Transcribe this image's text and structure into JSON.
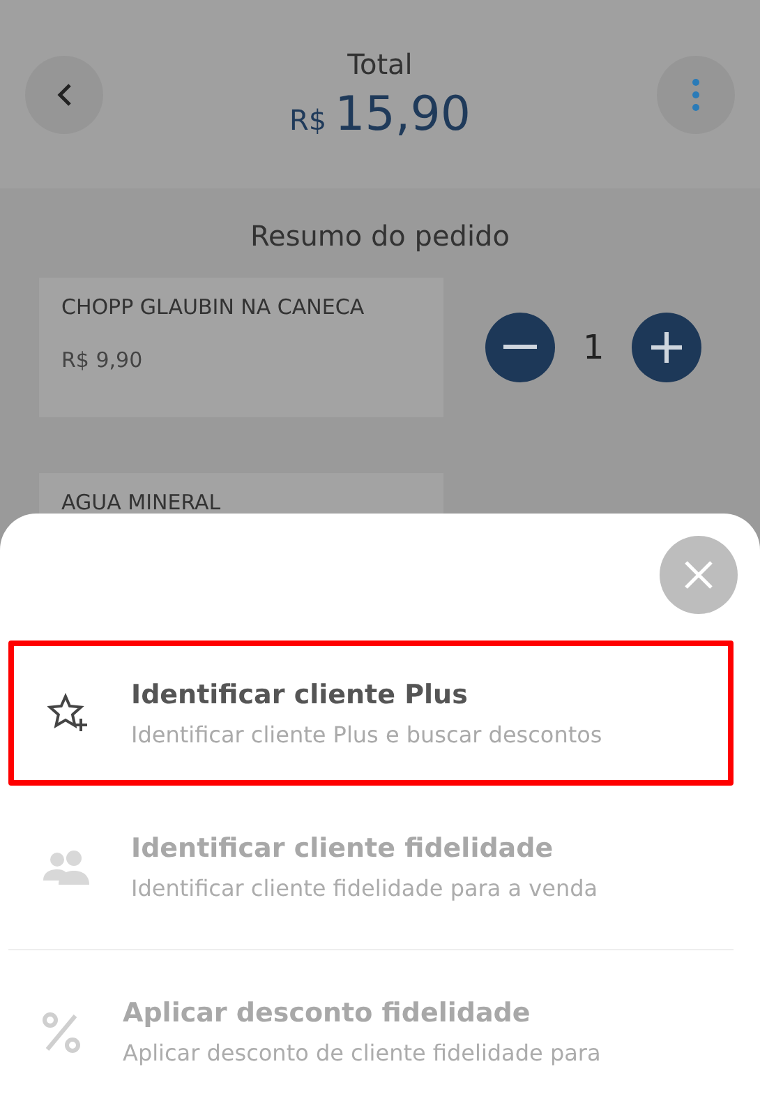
{
  "header": {
    "title": "Total",
    "currency": "R$",
    "amount": "15,90"
  },
  "summary": {
    "title": "Resumo do pedido",
    "items": [
      {
        "name": "CHOPP GLAUBIN NA CANECA",
        "price": "R$ 9,90",
        "quantity": "1"
      },
      {
        "name": "AGUA MINERAL"
      }
    ]
  },
  "sheet": {
    "options": [
      {
        "kind": "star-plus",
        "title": "Identificar cliente Plus",
        "subtitle": "Identificar cliente Plus e buscar descontos",
        "disabled": false,
        "highlighted": true
      },
      {
        "kind": "people",
        "title": "Identificar cliente fidelidade",
        "subtitle": "Identificar cliente fidelidade para a venda",
        "disabled": true,
        "highlighted": false
      },
      {
        "kind": "percent",
        "title": "Aplicar desconto fidelidade",
        "subtitle": "Aplicar desconto de cliente fidelidade para",
        "disabled": true,
        "highlighted": false
      }
    ]
  }
}
